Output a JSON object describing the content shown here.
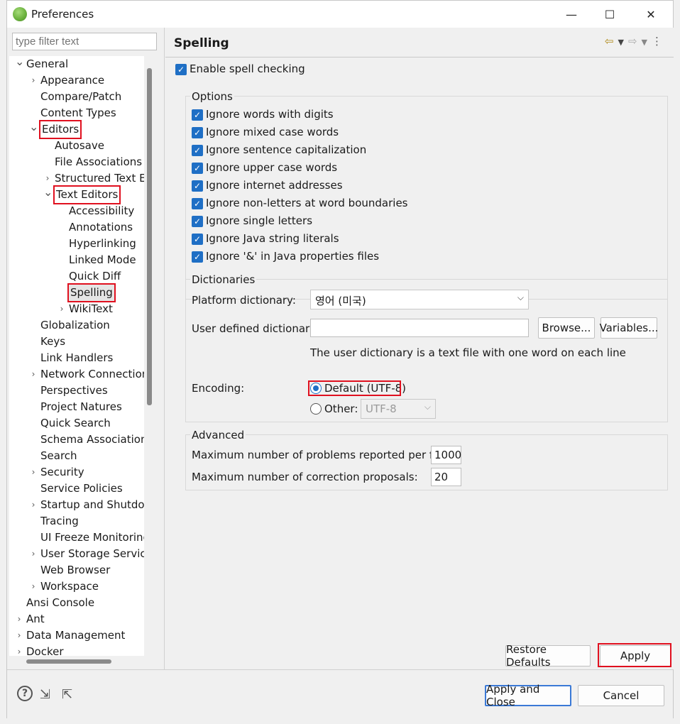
{
  "window": {
    "title": "Preferences",
    "minimize": "—",
    "maximize": "☐",
    "close": "✕"
  },
  "filter": {
    "placeholder": "type filter text"
  },
  "tree": [
    {
      "label": "General",
      "depth": 0,
      "arrow": "v"
    },
    {
      "label": "Appearance",
      "depth": 1,
      "arrow": ">"
    },
    {
      "label": "Compare/Patch",
      "depth": 1,
      "arrow": ""
    },
    {
      "label": "Content Types",
      "depth": 1,
      "arrow": ""
    },
    {
      "label": "Editors",
      "depth": 1,
      "arrow": "v",
      "highlight": true
    },
    {
      "label": "Autosave",
      "depth": 2,
      "arrow": ""
    },
    {
      "label": "File Associations",
      "depth": 2,
      "arrow": ""
    },
    {
      "label": "Structured Text Ec",
      "depth": 2,
      "arrow": ">"
    },
    {
      "label": "Text Editors",
      "depth": 2,
      "arrow": "v",
      "highlight": true
    },
    {
      "label": "Accessibility",
      "depth": 3,
      "arrow": ""
    },
    {
      "label": "Annotations",
      "depth": 3,
      "arrow": ""
    },
    {
      "label": "Hyperlinking",
      "depth": 3,
      "arrow": ""
    },
    {
      "label": "Linked Mode",
      "depth": 3,
      "arrow": ""
    },
    {
      "label": "Quick Diff",
      "depth": 3,
      "arrow": ""
    },
    {
      "label": "Spelling",
      "depth": 3,
      "arrow": "",
      "highlight": true,
      "selected": true
    },
    {
      "label": "WikiText",
      "depth": 3,
      "arrow": ">"
    },
    {
      "label": "Globalization",
      "depth": 1,
      "arrow": ""
    },
    {
      "label": "Keys",
      "depth": 1,
      "arrow": ""
    },
    {
      "label": "Link Handlers",
      "depth": 1,
      "arrow": ""
    },
    {
      "label": "Network Connection",
      "depth": 1,
      "arrow": ">"
    },
    {
      "label": "Perspectives",
      "depth": 1,
      "arrow": ""
    },
    {
      "label": "Project Natures",
      "depth": 1,
      "arrow": ""
    },
    {
      "label": "Quick Search",
      "depth": 1,
      "arrow": ""
    },
    {
      "label": "Schema Associations",
      "depth": 1,
      "arrow": ""
    },
    {
      "label": "Search",
      "depth": 1,
      "arrow": ""
    },
    {
      "label": "Security",
      "depth": 1,
      "arrow": ">"
    },
    {
      "label": "Service Policies",
      "depth": 1,
      "arrow": ""
    },
    {
      "label": "Startup and Shutdov",
      "depth": 1,
      "arrow": ">"
    },
    {
      "label": "Tracing",
      "depth": 1,
      "arrow": ""
    },
    {
      "label": "UI Freeze Monitoring",
      "depth": 1,
      "arrow": ""
    },
    {
      "label": "User Storage Service",
      "depth": 1,
      "arrow": ">"
    },
    {
      "label": "Web Browser",
      "depth": 1,
      "arrow": ""
    },
    {
      "label": "Workspace",
      "depth": 1,
      "arrow": ">"
    },
    {
      "label": "Ansi Console",
      "depth": 0,
      "arrow": ""
    },
    {
      "label": "Ant",
      "depth": 0,
      "arrow": ">"
    },
    {
      "label": "Data Management",
      "depth": 0,
      "arrow": ">"
    },
    {
      "label": "Docker",
      "depth": 0,
      "arrow": ">"
    }
  ],
  "page": {
    "title": "Spelling",
    "enable_spell": "Enable spell checking",
    "options_label": "Options",
    "options": [
      "Ignore words with digits",
      "Ignore mixed case words",
      "Ignore sentence capitalization",
      "Ignore upper case words",
      "Ignore internet addresses",
      "Ignore non-letters at word boundaries",
      "Ignore single letters",
      "Ignore Java string literals",
      "Ignore '&' in Java properties files"
    ],
    "dictionaries_label": "Dictionaries",
    "platform_dict_label": "Platform dictionary:",
    "platform_dict_value": "영어 (미국)",
    "user_dict_label": "User defined dictionary:",
    "user_dict_value": "",
    "browse": "Browse...",
    "variables": "Variables...",
    "user_dict_hint": "The user dictionary is a text file with one word on each line",
    "encoding_label": "Encoding:",
    "encoding_default": "Default (UTF-8)",
    "encoding_other": "Other:",
    "encoding_other_value": "UTF-8",
    "advanced_label": "Advanced",
    "max_problems_label": "Maximum number of problems reported per file:",
    "max_problems_value": "1000",
    "max_proposals_label": "Maximum number of correction proposals:",
    "max_proposals_value": "20",
    "restore_defaults": "Restore Defaults",
    "apply": "Apply"
  },
  "footer": {
    "apply_close": "Apply and Close",
    "cancel": "Cancel"
  },
  "icons": {
    "help": "help-icon",
    "import": "import-icon",
    "export": "export-icon"
  },
  "colors": {
    "accent": "#1f6fc5",
    "highlight_box": "#e0101f"
  }
}
